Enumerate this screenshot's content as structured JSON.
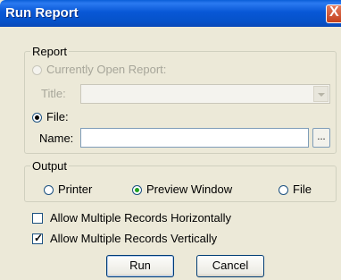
{
  "window": {
    "title": "Run Report",
    "close_glyph": "X"
  },
  "report_group": {
    "legend": "Report",
    "currently_open_label": "Currently Open Report:",
    "title_label": "Title:",
    "title_value": "",
    "file_label": "File:",
    "name_label": "Name:",
    "name_value": "",
    "browse_label": "...",
    "currently_open_selected": false,
    "file_selected": true
  },
  "output_group": {
    "legend": "Output",
    "options": [
      "Printer",
      "Preview Window",
      "File"
    ],
    "selected": "Preview Window"
  },
  "checkboxes": {
    "horizontal_label": "Allow Multiple Records Horizontally",
    "horizontal_checked": false,
    "vertical_label": "Allow Multiple Records Vertically",
    "vertical_checked": true
  },
  "buttons": {
    "run_label": "Run",
    "cancel_label": "Cancel"
  },
  "icons": {
    "close": "close-icon",
    "dropdown": "chevron-down-icon"
  }
}
